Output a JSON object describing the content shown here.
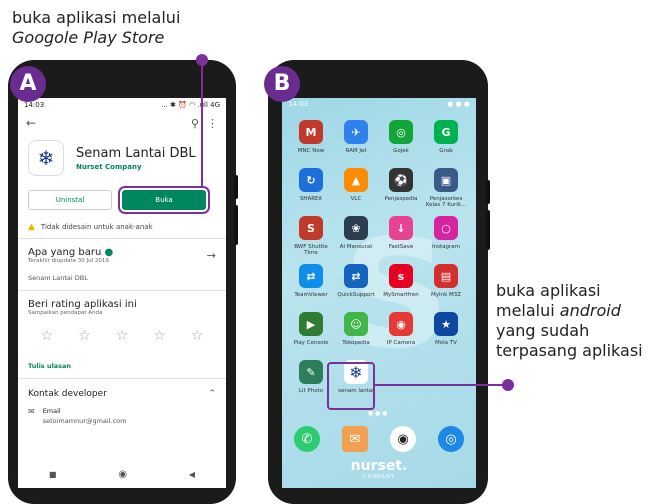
{
  "annotations": {
    "top_line1": "buka aplikasi melalui",
    "top_line2": "Googole Play Store",
    "right_line1": "buka aplikasi",
    "right_line2a": "melalui ",
    "right_line2b": "android",
    "right_line3": "yang sudah",
    "right_line4": "terpasang aplikasi"
  },
  "labels": {
    "a": "A",
    "b": "B"
  },
  "phoneA": {
    "time": "14:03",
    "status_right": "... ✱ ⏰ ◠ .ull 4G  ",
    "app_name": "Senam Lantai DBL",
    "developer": "Nurset Company",
    "uninstall": "Uninstal",
    "open": "Buka",
    "warning": "Tidak didesain untuk anak-anak",
    "whats_new_title": "Apa yang baru",
    "whats_new_sub": "Terakhir diupdate 30 Jul 2019",
    "whats_new_body": "Senam Lantai DBL",
    "rate_title": "Beri rating aplikasi ini",
    "rate_sub": "Sampaikan pendapat Anda",
    "write_review": "Tulis ulasan",
    "contact_title": "Kontak developer",
    "email_label": "Email",
    "email_value": "setoimamnur@gmail.com"
  },
  "phoneB": {
    "time": "14:03",
    "apps": [
      {
        "label": "MNC Now",
        "color": "#c0392b",
        "glyph": "M"
      },
      {
        "label": "RAM Jet",
        "color": "#2f80ed",
        "glyph": "✈"
      },
      {
        "label": "Gojek",
        "color": "#13a538",
        "glyph": "◎"
      },
      {
        "label": "Grab",
        "color": "#00b14f",
        "glyph": "G"
      },
      {
        "label": "SHAREit",
        "color": "#1e6fd9",
        "glyph": "↻"
      },
      {
        "label": "VLC",
        "color": "#ff8c00",
        "glyph": "▲"
      },
      {
        "label": "Penjaspedia",
        "color": "#333333",
        "glyph": "⚽"
      },
      {
        "label": "Penjasorkes Kelas 7 Kurik...",
        "color": "#3a5a8a",
        "glyph": "▣"
      },
      {
        "label": "BWF Shuttle Time",
        "color": "#c0392b",
        "glyph": "S"
      },
      {
        "label": "AI Mansurat",
        "color": "#2c3e50",
        "glyph": "❀"
      },
      {
        "label": "FastSave",
        "color": "#e84393",
        "glyph": "↓"
      },
      {
        "label": "Instagram",
        "color": "#d6249f",
        "glyph": "○"
      },
      {
        "label": "TeamViewer",
        "color": "#0e8ee9",
        "glyph": "⇄"
      },
      {
        "label": "QuickSupport",
        "color": "#1565c0",
        "glyph": "⇄"
      },
      {
        "label": "MySmartfren",
        "color": "#e60023",
        "glyph": "s"
      },
      {
        "label": "MyInk M3Z",
        "color": "#d32f2f",
        "glyph": "▤"
      },
      {
        "label": "Play Console",
        "color": "#2e7d32",
        "glyph": "▶"
      },
      {
        "label": "Tokopedia",
        "color": "#42b549",
        "glyph": "☺"
      },
      {
        "label": "IP Camera",
        "color": "#e53935",
        "glyph": "◉"
      },
      {
        "label": "Mola TV",
        "color": "#0d47a1",
        "glyph": "★"
      },
      {
        "label": "Lit Photo",
        "color": "#2e7d5b",
        "glyph": "✎"
      },
      {
        "label": "senam lantai",
        "color": "#ffffff",
        "glyph": "❄"
      }
    ],
    "watermark": "nurset.",
    "watermark_sub": "COMPANY"
  }
}
